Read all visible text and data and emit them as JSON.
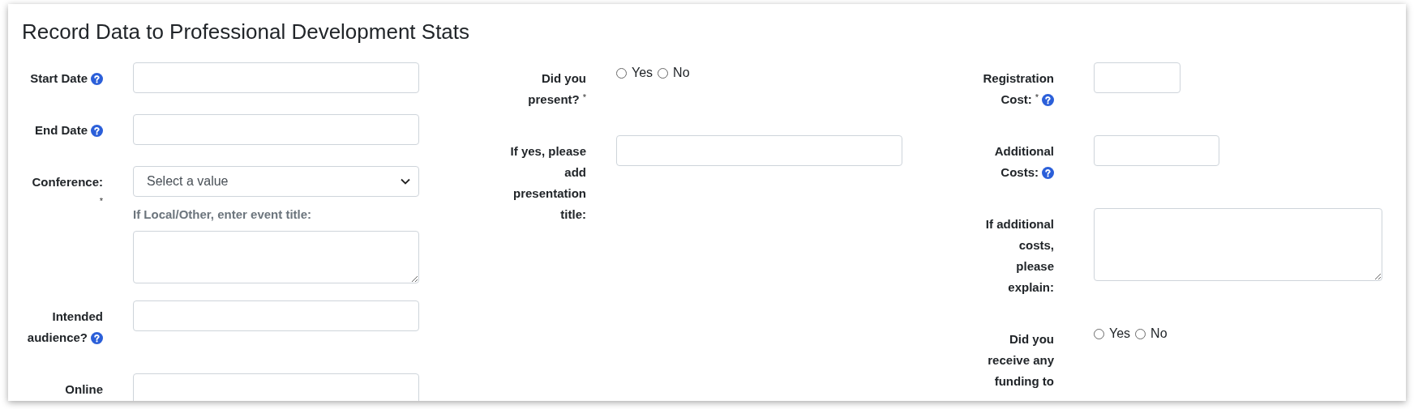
{
  "title": "Record Data to Professional Development Stats",
  "columns": [
    {
      "rows": [
        {
          "label_lines": [
            [
              {
                "kind": "text",
                "text": "Start Date"
              },
              {
                "kind": "help"
              }
            ]
          ],
          "field": {
            "kind": "text"
          }
        },
        {
          "label_lines": [
            [
              {
                "kind": "text",
                "text": "End Date"
              },
              {
                "kind": "help"
              }
            ]
          ],
          "field": {
            "kind": "text"
          }
        },
        {
          "label_lines": [
            [
              {
                "kind": "text",
                "text": "Conference:"
              }
            ],
            [
              {
                "kind": "required",
                "text": "*"
              }
            ]
          ],
          "field": {
            "kind": "select",
            "value": "Select a value"
          },
          "note": "If Local/Other, enter event title:",
          "extra": {
            "kind": "textarea"
          }
        },
        {
          "label_lines": [
            [
              {
                "kind": "text",
                "text": "Intended"
              }
            ],
            [
              {
                "kind": "text",
                "text": "audience?"
              },
              {
                "kind": "help"
              }
            ]
          ],
          "field": {
            "kind": "text"
          }
        },
        {
          "label_lines": [
            [
              {
                "kind": "text",
                "text": "Online"
              }
            ]
          ],
          "field": {
            "kind": "text"
          }
        }
      ]
    },
    {
      "rows": [
        {
          "label_lines": [
            [
              {
                "kind": "text",
                "text": "Did you"
              }
            ],
            [
              {
                "kind": "text",
                "text": "present?"
              },
              {
                "kind": "required",
                "text": "*"
              }
            ]
          ],
          "field": {
            "kind": "radio",
            "options": [
              {
                "label": "Yes",
                "selected": false
              },
              {
                "label": "No",
                "selected": false
              }
            ]
          }
        },
        {
          "label_lines": [
            [
              {
                "kind": "text",
                "text": "If yes, please"
              }
            ],
            [
              {
                "kind": "text",
                "text": "add"
              }
            ],
            [
              {
                "kind": "text",
                "text": "presentation"
              }
            ],
            [
              {
                "kind": "text",
                "text": "title:"
              }
            ]
          ],
          "field": {
            "kind": "text"
          }
        }
      ]
    },
    {
      "rows": [
        {
          "label_lines": [
            [
              {
                "kind": "text",
                "text": "Registration"
              }
            ],
            [
              {
                "kind": "text",
                "text": "Cost:"
              },
              {
                "kind": "required",
                "text": "*"
              },
              {
                "kind": "help"
              }
            ]
          ],
          "field": {
            "kind": "text"
          }
        },
        {
          "label_lines": [
            [
              {
                "kind": "text",
                "text": "Additional"
              }
            ],
            [
              {
                "kind": "text",
                "text": "Costs:"
              },
              {
                "kind": "help"
              }
            ]
          ],
          "field": {
            "kind": "text"
          }
        },
        {
          "label_lines": [
            [
              {
                "kind": "text",
                "text": "If additional"
              }
            ],
            [
              {
                "kind": "text",
                "text": "costs,"
              }
            ],
            [
              {
                "kind": "text",
                "text": "please"
              }
            ],
            [
              {
                "kind": "text",
                "text": "explain:"
              }
            ]
          ],
          "field": {
            "kind": "textarea"
          }
        },
        {
          "label_lines": [
            [
              {
                "kind": "text",
                "text": "Did you"
              }
            ],
            [
              {
                "kind": "text",
                "text": "receive any"
              }
            ],
            [
              {
                "kind": "text",
                "text": "funding to"
              }
            ]
          ],
          "field": {
            "kind": "radio",
            "options": [
              {
                "label": "Yes",
                "selected": false
              },
              {
                "label": "No",
                "selected": false
              }
            ]
          }
        }
      ]
    }
  ]
}
